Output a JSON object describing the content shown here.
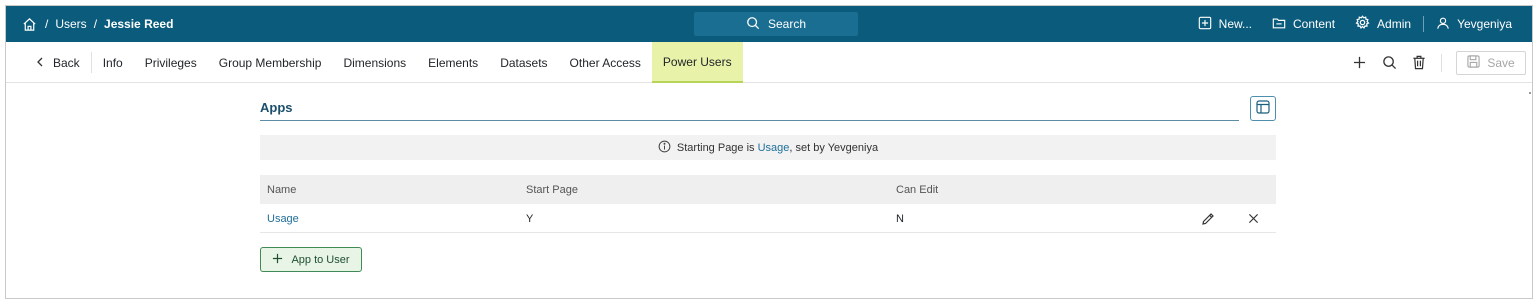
{
  "breadcrumb": {
    "users": "Users",
    "separator": "/",
    "current": "Jessie Reed"
  },
  "search": {
    "label": "Search"
  },
  "top_actions": {
    "new": "New...",
    "content": "Content",
    "admin": "Admin",
    "user": "Yevgeniya"
  },
  "tabs": {
    "back": "Back",
    "items": [
      "Info",
      "Privileges",
      "Group Membership",
      "Dimensions",
      "Elements",
      "Datasets",
      "Other Access",
      "Power Users"
    ],
    "active": "Power Users"
  },
  "toolbar": {
    "save_label": "Save"
  },
  "section": {
    "title": "Apps"
  },
  "info": {
    "prefix": "Starting Page is ",
    "link": "Usage",
    "suffix": ", set by Yevgeniya"
  },
  "table": {
    "headers": [
      "Name",
      "Start Page",
      "Can Edit"
    ],
    "rows": [
      {
        "name": "Usage",
        "start_page": "Y",
        "can_edit": "N"
      }
    ]
  },
  "add_button": {
    "label": "App to User"
  },
  "colors": {
    "topbar": "#0b5b7d",
    "active_tab": "#e8f2a8",
    "link": "#1f6f99",
    "add_button_border": "#3f8a55"
  },
  "icons": [
    "home-icon",
    "search-icon",
    "plus-square-icon",
    "folder-icon",
    "gear-icon",
    "user-icon",
    "chevron-left-icon",
    "plus-icon",
    "trash-icon",
    "save-icon",
    "layout-icon",
    "info-icon",
    "pencil-icon",
    "close-icon"
  ]
}
